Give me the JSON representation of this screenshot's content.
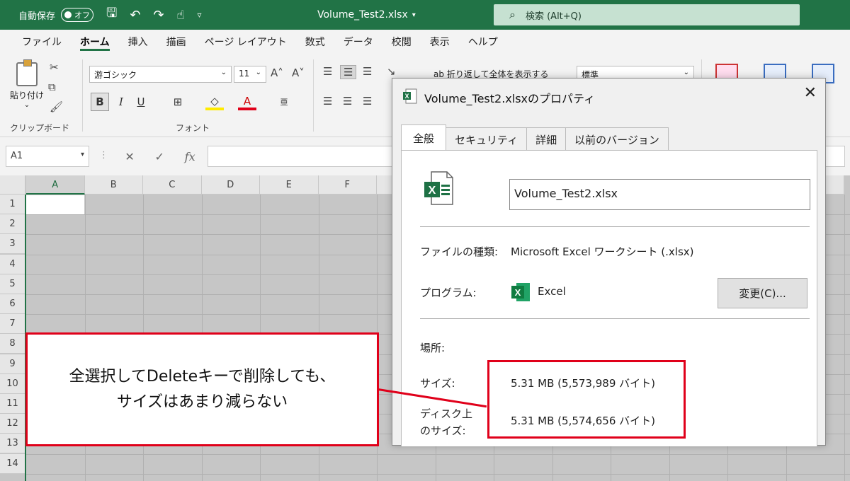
{
  "titlebar": {
    "autosave_label": "自動保存",
    "autosave_state": "オフ",
    "document_title": "Volume_Test2.xlsx",
    "search_placeholder": "検索 (Alt+Q)"
  },
  "menu": {
    "tabs": [
      "ファイル",
      "ホーム",
      "挿入",
      "描画",
      "ページ レイアウト",
      "数式",
      "データ",
      "校閲",
      "表示",
      "ヘルプ"
    ],
    "active": "ホーム"
  },
  "ribbon": {
    "paste_label": "貼り付け",
    "clipboard_group": "クリップボード",
    "font_group": "フォント",
    "font_name": "游ゴシック",
    "font_size": "11",
    "bold": "B",
    "italic": "I",
    "underline": "U",
    "wrap_text": "折り返して全体を表示する",
    "number_format": "標準"
  },
  "formula_bar": {
    "name_box": "A1",
    "fx": "fx"
  },
  "grid": {
    "columns": [
      "A",
      "B",
      "C",
      "D",
      "E",
      "F"
    ],
    "rows": [
      "1",
      "2",
      "3",
      "4",
      "5",
      "6",
      "7",
      "8",
      "9",
      "10",
      "11",
      "12",
      "13",
      "14"
    ]
  },
  "dialog": {
    "title": "Volume_Test2.xlsxのプロパティ",
    "tabs": [
      "全般",
      "セキュリティ",
      "詳細",
      "以前のバージョン"
    ],
    "file_name": "Volume_Test2.xlsx",
    "file_type_label": "ファイルの種類:",
    "file_type_value": "Microsoft Excel ワークシート (.xlsx)",
    "program_label": "プログラム:",
    "program_value": "Excel",
    "change_button": "変更(C)...",
    "location_label": "場所:",
    "size_label": "サイズ:",
    "size_value": "5.31 MB (5,573,989 バイト)",
    "disk_size_label_1": "ディスク上",
    "disk_size_label_2": "のサイズ:",
    "disk_size_value": "5.31 MB (5,574,656 バイト)"
  },
  "annotation": {
    "line1": "全選択してDeleteキーで削除しても、",
    "line2": "サイズはあまり減らない"
  },
  "colors": {
    "excel_green": "#217346",
    "annotation_red": "#e0001a"
  }
}
